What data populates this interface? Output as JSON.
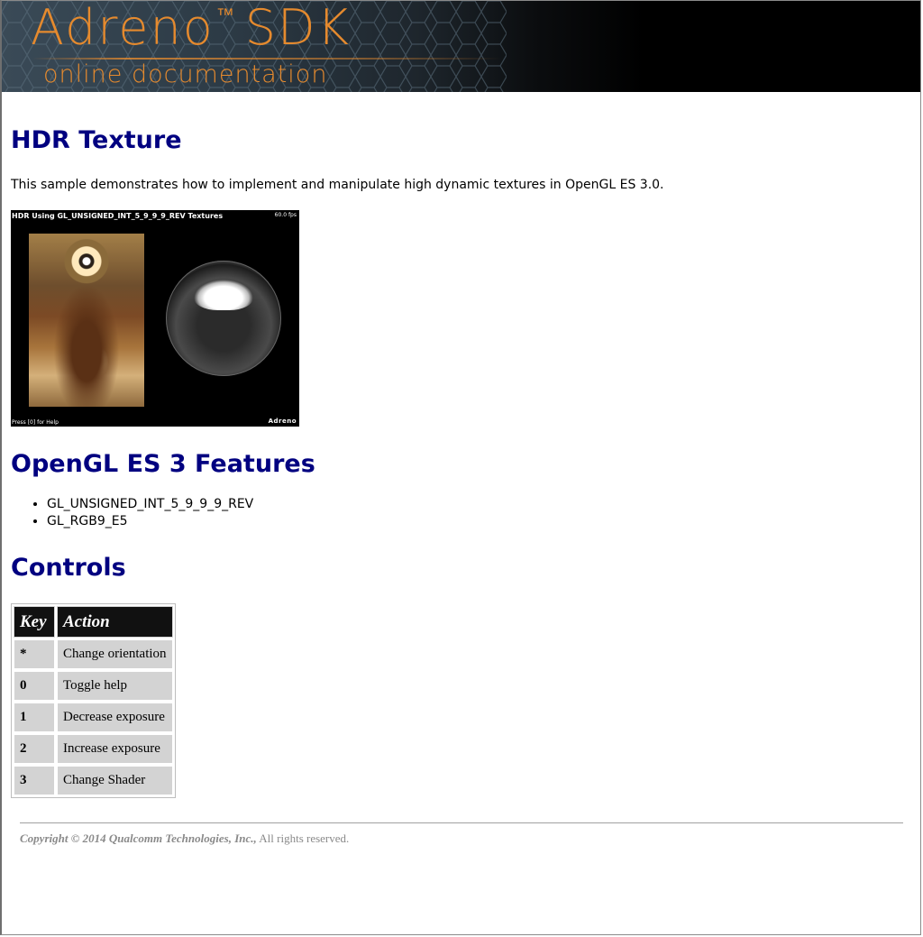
{
  "banner": {
    "brand": "Adreno",
    "trademark": "™",
    "product": "SDK",
    "subtitle": "online documentation",
    "accent_color": "#e58a2e"
  },
  "page": {
    "title": "HDR Texture",
    "intro": "This sample demonstrates how to implement and manipulate high dynamic textures in OpenGL ES 3.0."
  },
  "screenshot": {
    "caption": "HDR Using GL_UNSIGNED_INT_5_9_9_9_REV Textures",
    "fps": "60.0 fps",
    "help": "Press [0] for Help",
    "logo": "Adreno"
  },
  "features": {
    "heading": "OpenGL ES 3 Features",
    "items": [
      "GL_UNSIGNED_INT_5_9_9_9_REV",
      "GL_RGB9_E5"
    ]
  },
  "controls": {
    "heading": "Controls",
    "columns": [
      "Key",
      "Action"
    ],
    "rows": [
      {
        "key": "*",
        "action": "Change orientation"
      },
      {
        "key": "0",
        "action": "Toggle help"
      },
      {
        "key": "1",
        "action": "Decrease exposure"
      },
      {
        "key": "2",
        "action": "Increase exposure"
      },
      {
        "key": "3",
        "action": "Change Shader"
      }
    ]
  },
  "footer": {
    "copyright_prefix": "Copyright © 2014 Qualcomm Technologies, Inc.,",
    "copyright_suffix": " All rights reserved."
  }
}
